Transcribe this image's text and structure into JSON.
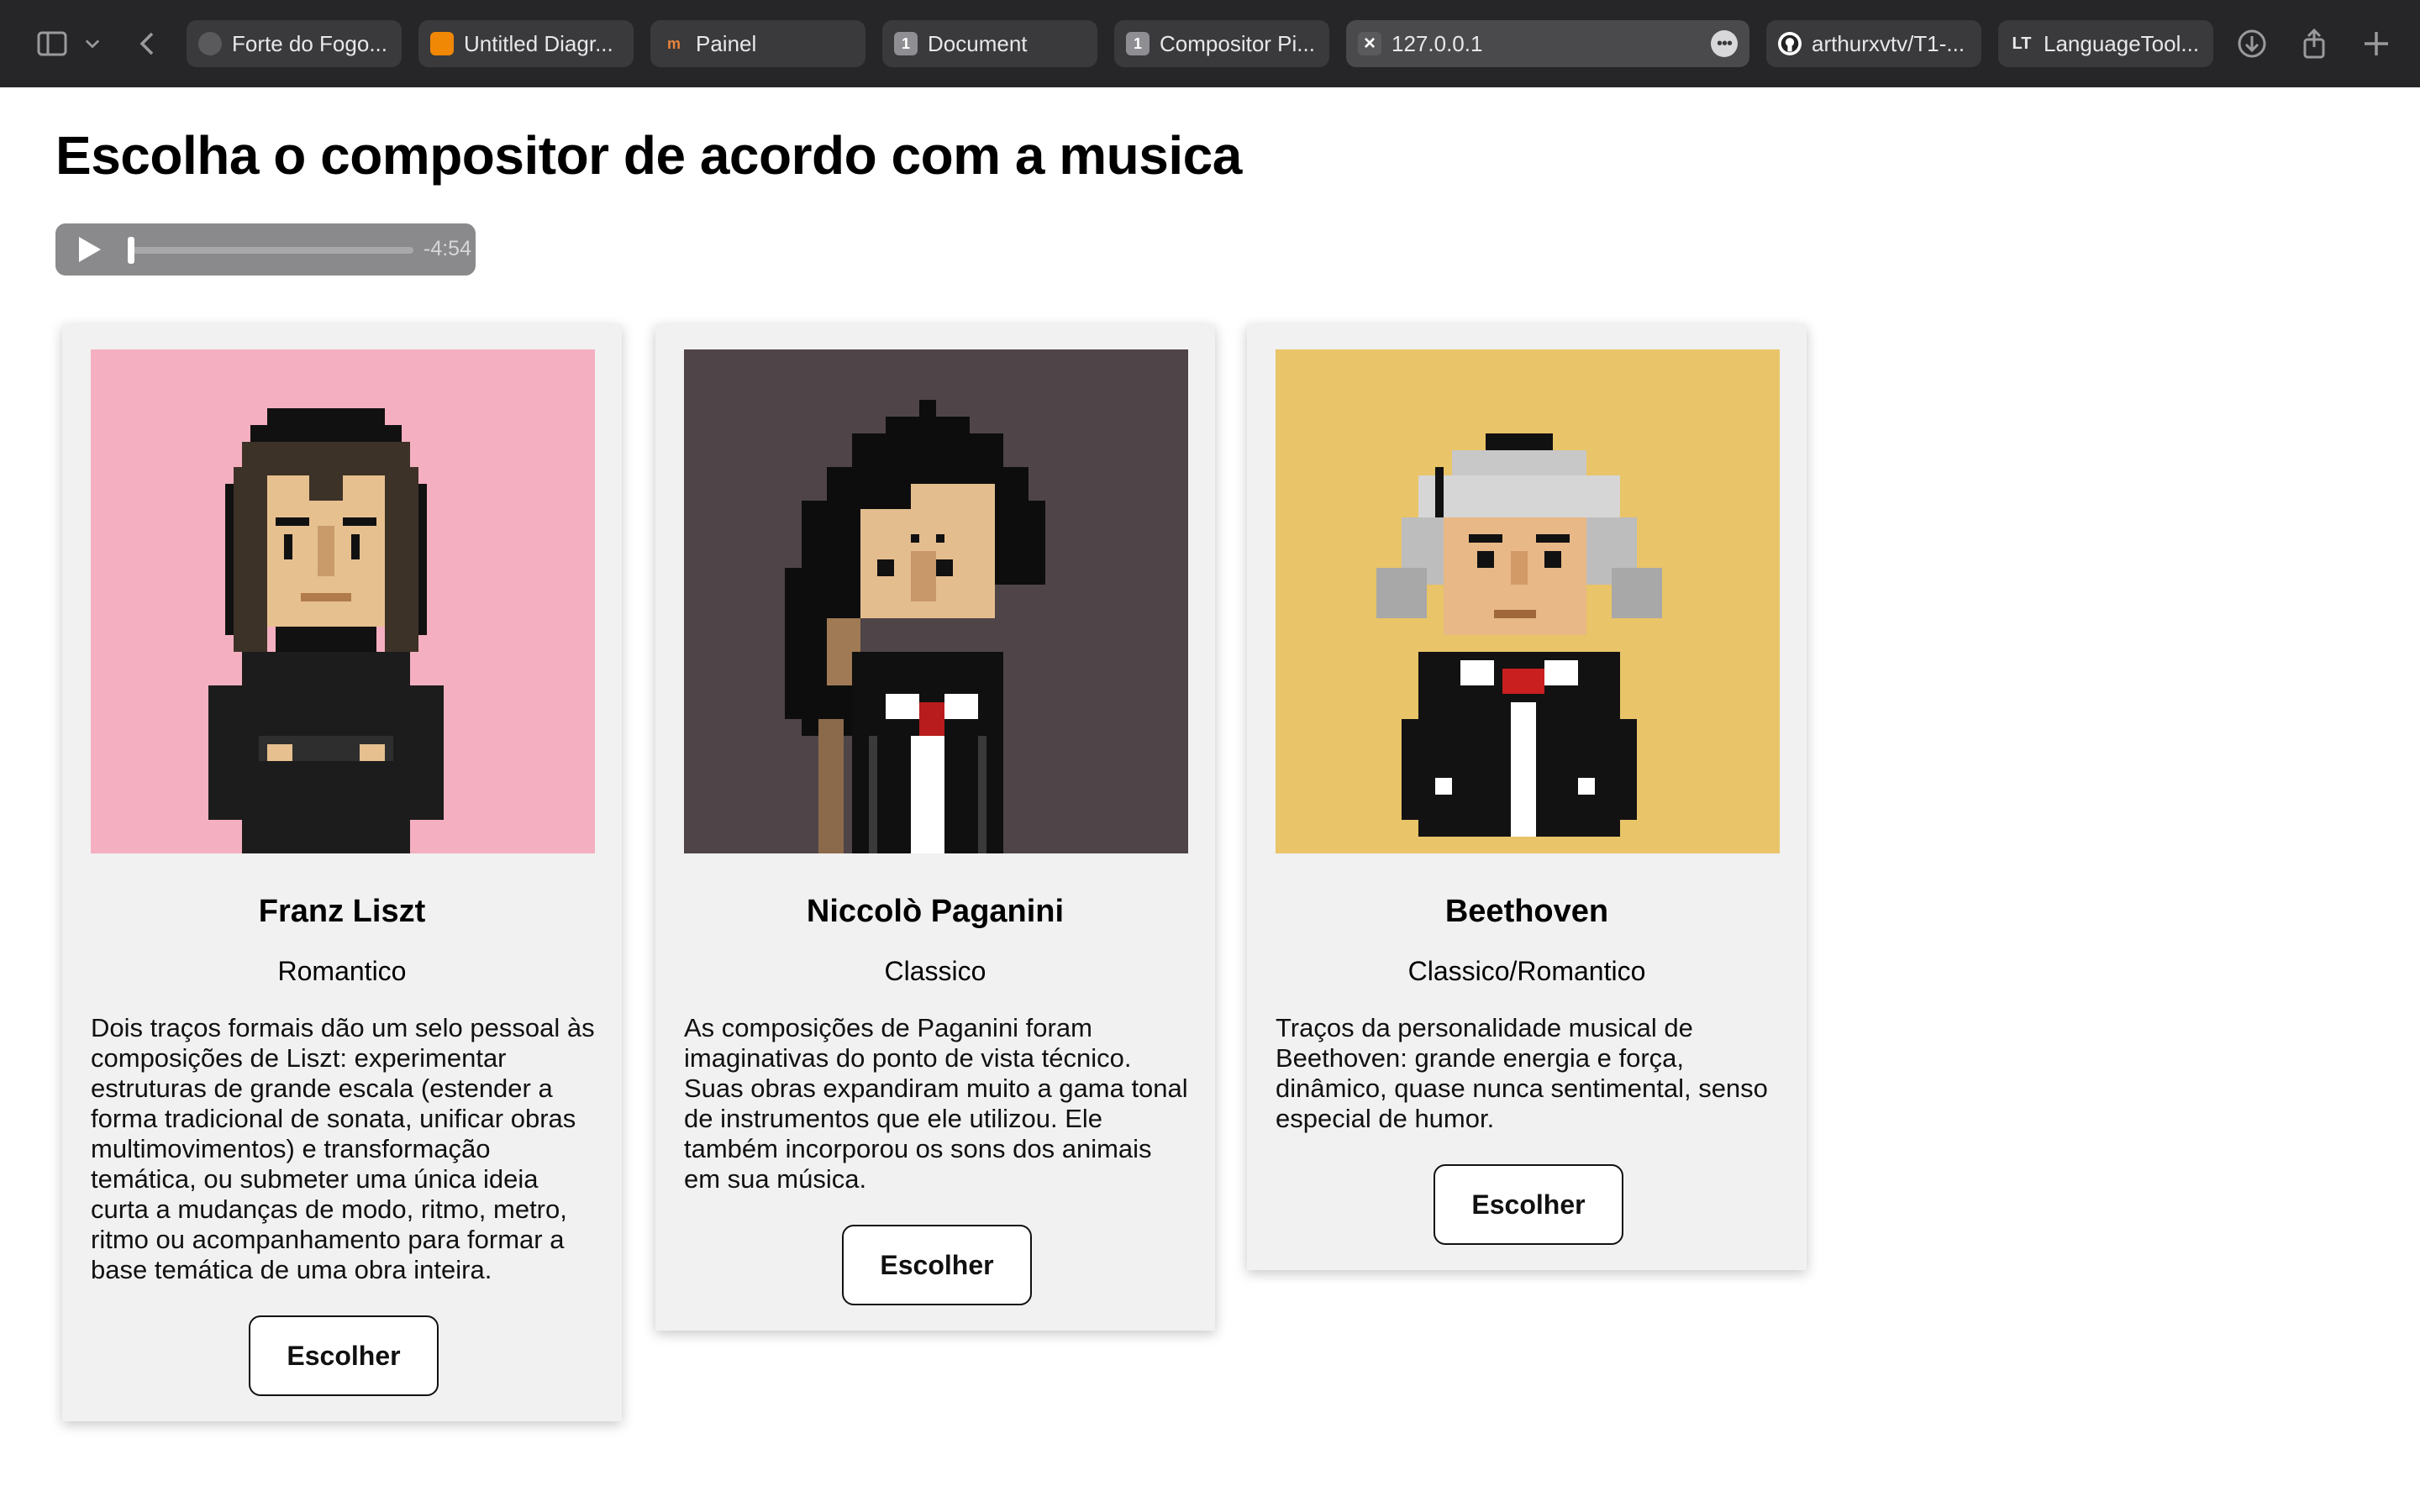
{
  "browser": {
    "tabs": [
      {
        "title": "Forte do Fogo...",
        "favicon_color": "#5a5a5c",
        "favicon_text": ""
      },
      {
        "title": "Untitled Diagr...",
        "favicon_color": "#f08705",
        "favicon_text": ""
      },
      {
        "title": "Painel",
        "favicon_color": "#3a3a3c",
        "favicon_text": "m"
      },
      {
        "title": "Document",
        "favicon_color": "#8e8e93",
        "favicon_text": "1"
      },
      {
        "title": "Compositor Pi...",
        "favicon_color": "#8e8e93",
        "favicon_text": "1"
      },
      {
        "title": "127.0.0.1",
        "favicon_color": "#5a5a5c",
        "favicon_text": "×"
      },
      {
        "title": "arthurxvtv/T1-...",
        "favicon_color": "#ffffff",
        "favicon_text": ""
      },
      {
        "title": "LanguageTool...",
        "favicon_color": "#3a3a3c",
        "favicon_text": ""
      }
    ]
  },
  "page": {
    "title": "Escolha o compositor de acordo com a musica"
  },
  "audio": {
    "time_remaining": "-4:54",
    "progress": 0
  },
  "composers": [
    {
      "name": "Franz Liszt",
      "era": "Romantico",
      "description": "Dois traços formais dão um selo pessoal às composições de Liszt: experimentar estruturas de grande escala (estender a forma tradicional de sonata, unificar obras multimovimentos) e transformação temática, ou submeter uma única ideia curta a mudanças de modo, ritmo, metro, ritmo ou acompanhamento para formar a base temática de uma obra inteira.",
      "button": "Escolher",
      "background": "#f4afc0"
    },
    {
      "name": "Niccolò Paganini",
      "era": "Classico",
      "description": "As composições de Paganini foram imaginativas do ponto de vista técnico. Suas obras expandiram muito a gama tonal de instrumentos que ele utilizou. Ele também incorporou os sons dos animais em sua música.",
      "button": "Escolher",
      "background": "#4f4548"
    },
    {
      "name": "Beethoven",
      "era": "Classico/Romantico",
      "description": "Traços da personalidade musical de Beethoven: grande energia e força, dinâmico, quase nunca sentimental, senso especial de humor.",
      "button": "Escolher",
      "background": "#e9c468"
    }
  ]
}
